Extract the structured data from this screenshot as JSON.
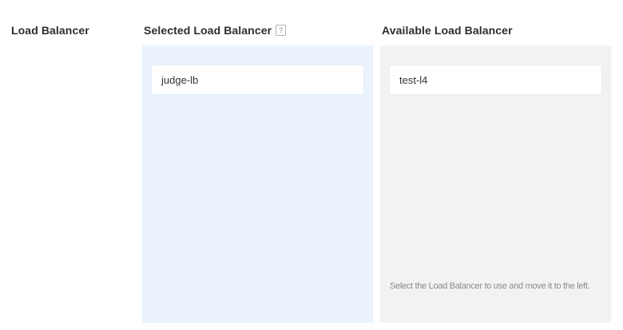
{
  "section": {
    "label": "Load Balancer"
  },
  "selected": {
    "header": "Selected Load Balancer",
    "help_icon": "?",
    "items": [
      {
        "label": "judge-lb"
      }
    ]
  },
  "available": {
    "header": "Available Load Balancer",
    "items": [
      {
        "label": "test-l4"
      }
    ],
    "hint": "Select the Load Balancer to use and move it to the left."
  },
  "colors": {
    "selected_panel_bg": "#eaf3fb",
    "available_panel_bg": "#f2f2f2",
    "item_bg": "#ffffff"
  }
}
